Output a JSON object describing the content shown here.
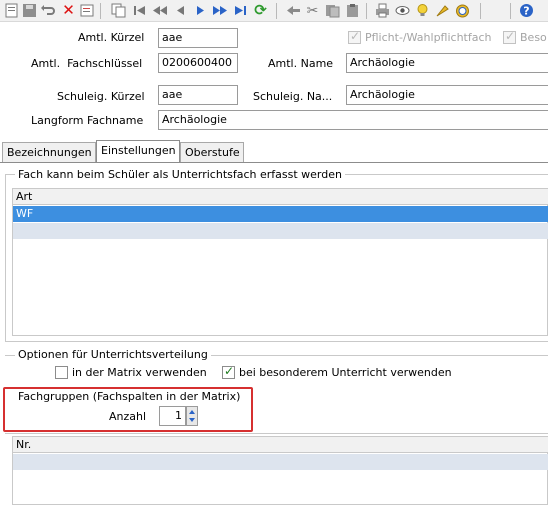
{
  "toolbar": {
    "icons": [
      "first-record",
      "save",
      "undo",
      "delete",
      "edit",
      "copy",
      "nav-first",
      "nav-prev-page",
      "nav-prev",
      "nav-next",
      "nav-next-page",
      "nav-last",
      "refresh",
      "back",
      "cut",
      "paste",
      "print",
      "preview",
      "idea",
      "wizard",
      "settings",
      "help"
    ]
  },
  "form": {
    "kurzel_label": "Amtl. Kürzel",
    "kurzel_value": "aae",
    "pflicht_label": "Pflicht-/Wahlpflichtfach",
    "beso_label": "Beso",
    "fachschl_label": "Amtl.  Fachschlüssel",
    "fachschl_value": "0200600400",
    "name_label": "Amtl. Name",
    "name_value": "Archäologie",
    "schul_kurzel_label": "Schuleig. Kürzel",
    "schul_kurzel_value": "aae",
    "schul_name_label": "Schuleig. Na...",
    "schul_name_value": "Archäologie",
    "langform_label": "Langform Fachname",
    "langform_value": "Archäologie"
  },
  "tabs": [
    {
      "label": "Bezeichnungen"
    },
    {
      "label": "Einstellungen"
    },
    {
      "label": "Oberstufe"
    }
  ],
  "fach_group": {
    "title": "Fach kann beim Schüler als Unterrichtsfach erfasst werden",
    "column": "Art",
    "rows": [
      "WF"
    ]
  },
  "optionen": {
    "title": "Optionen für Unterrichtsverteilung",
    "matrix_label": "in der Matrix verwenden",
    "besonder_label": "bei besonderem Unterricht verwenden"
  },
  "fachgruppen": {
    "title": "Fachgruppen (Fachspalten in der Matrix)",
    "anzahl_label": "Anzahl",
    "anzahl_value": "1",
    "column": "Nr."
  }
}
